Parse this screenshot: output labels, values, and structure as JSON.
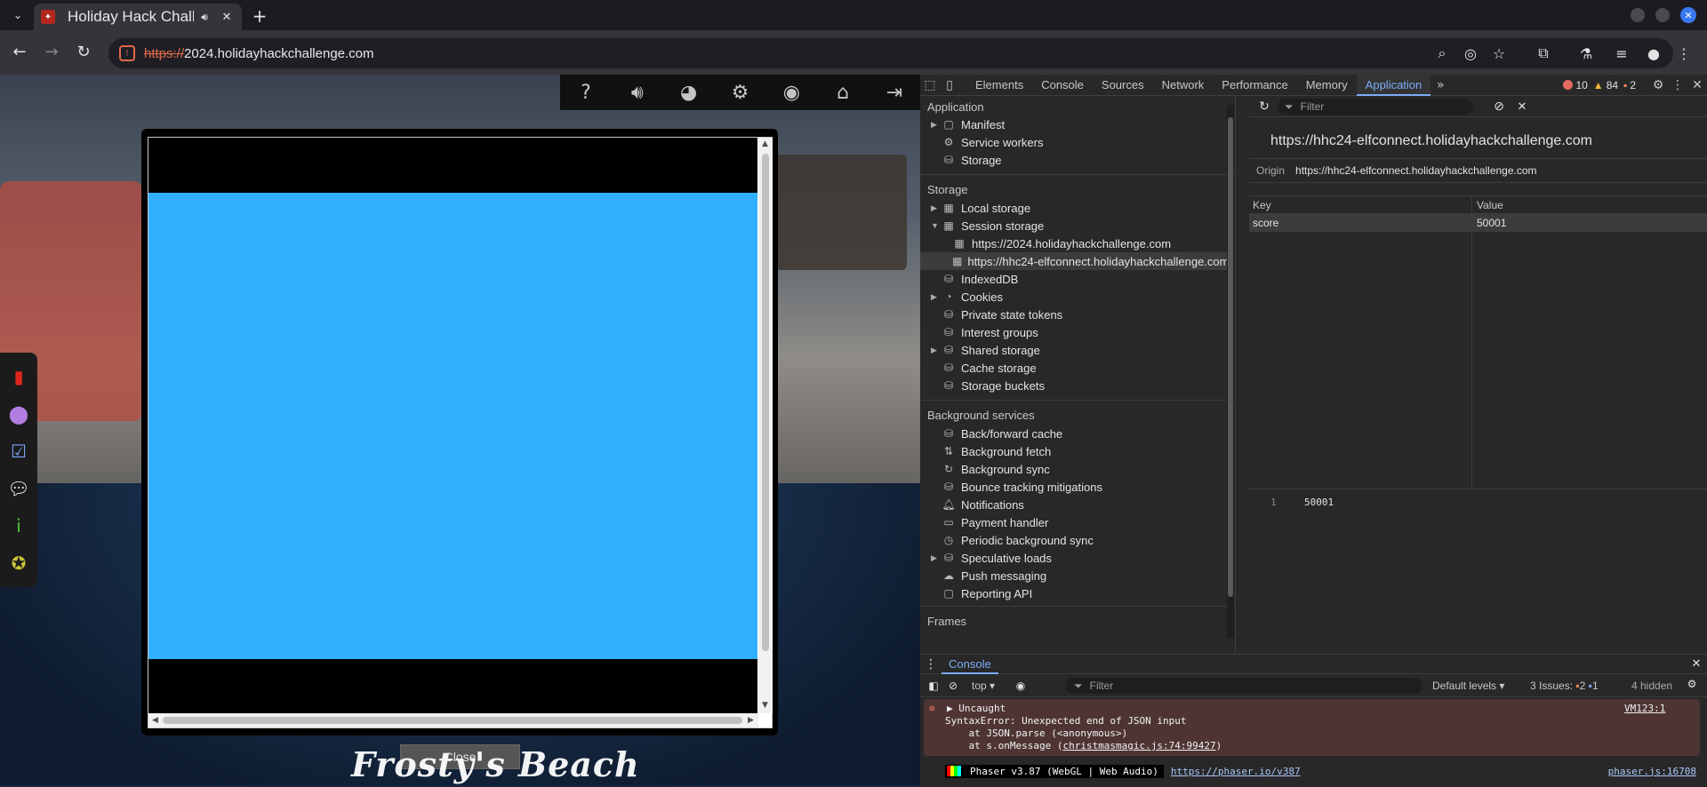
{
  "browser": {
    "tab_title": "Holiday Hack Challenge",
    "url_scheme": "https://",
    "url_host": "2024.holidayhackchallenge.com"
  },
  "game": {
    "close_label": "Close",
    "location_label": "Frosty's Beach",
    "toolbar_icons": [
      "help-icon",
      "volume-icon",
      "discord-icon",
      "settings-icon",
      "profile-icon",
      "home-icon",
      "logout-icon"
    ],
    "sidebar_icons": [
      "book-icon",
      "map-pin-icon",
      "checklist-icon",
      "chat-icon",
      "info-icon",
      "badge-icon"
    ],
    "frame_blue": "#30b0ff"
  },
  "devtools": {
    "tabs": [
      "Elements",
      "Console",
      "Sources",
      "Network",
      "Performance",
      "Memory",
      "Application"
    ],
    "active_tab": "Application",
    "errors": "10",
    "warnings": "84",
    "issues": "2",
    "left": {
      "application_header": "Application",
      "application_items": [
        "Manifest",
        "Service workers",
        "Storage"
      ],
      "storage_header": "Storage",
      "storage_items": [
        "Local storage",
        "Session storage"
      ],
      "session_children": [
        "https://2024.holidayhackchallenge.com",
        "https://hhc24-elfconnect.holidayhackchallenge.com"
      ],
      "storage_more": [
        "IndexedDB",
        "Cookies",
        "Private state tokens",
        "Interest groups",
        "Shared storage",
        "Cache storage",
        "Storage buckets"
      ],
      "background_header": "Background services",
      "background_items": [
        "Back/forward cache",
        "Background fetch",
        "Background sync",
        "Bounce tracking mitigations",
        "Notifications",
        "Payment handler",
        "Periodic background sync",
        "Speculative loads",
        "Push messaging",
        "Reporting API"
      ],
      "frames_header": "Frames"
    },
    "right": {
      "filter_placeholder": "Filter",
      "origin_title": "https://hhc24-elfconnect.holidayhackchallenge.com",
      "origin_label": "Origin",
      "origin_value": "https://hhc24-elfconnect.holidayhackchallenge.com",
      "col_key": "Key",
      "col_value": "Value",
      "row_key": "score",
      "row_value": "50001",
      "preview_line_no": "1",
      "preview_value": "50001"
    },
    "console": {
      "tab": "Console",
      "context": "top",
      "filter_placeholder": "Filter",
      "levels": "Default levels",
      "issues_label": "3 Issues:",
      "issues_warn": "2",
      "issues_info": "1",
      "hidden": "4 hidden",
      "err_title": "Uncaught",
      "err_line1": "SyntaxError: Unexpected end of JSON input",
      "err_line2": "    at JSON.parse (<anonymous>)",
      "err_line3_prefix": "    at s.onMessage (",
      "err_line3_link": "christmasmagic.js:74:99427",
      "err_line3_suffix": ")",
      "err_source": "VM123:1",
      "log_text": "Phaser v3.87 (WebGL | Web Audio)",
      "log_link": "https://phaser.io/v387",
      "log_source": "phaser.js:16708"
    }
  }
}
